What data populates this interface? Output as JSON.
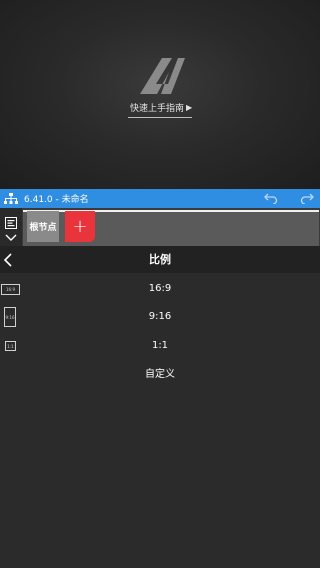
{
  "preview": {
    "guide_label": "快速上手指南"
  },
  "topbar": {
    "title": "6.41.0 - 未命名"
  },
  "nodebar": {
    "root_node": "根节点",
    "add_label": "+"
  },
  "panel": {
    "title": "比例",
    "options": [
      {
        "label": "16:9",
        "icon_text": "16:9"
      },
      {
        "label": "9:16",
        "icon_text": "9:16"
      },
      {
        "label": "1:1",
        "icon_text": "1:1"
      },
      {
        "label": "自定义"
      }
    ]
  },
  "colors": {
    "accent_blue": "#2f8ee2",
    "add_red": "#e8343a"
  }
}
